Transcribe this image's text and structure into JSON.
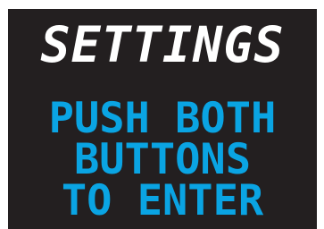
{
  "screen": {
    "title": "SETTINGS",
    "message_lines": [
      "PUSH BOTH",
      "BUTTONS",
      "TO ENTER"
    ]
  },
  "colors": {
    "background": "#231f20",
    "title": "#ffffff",
    "message": "#0aa4e3"
  }
}
